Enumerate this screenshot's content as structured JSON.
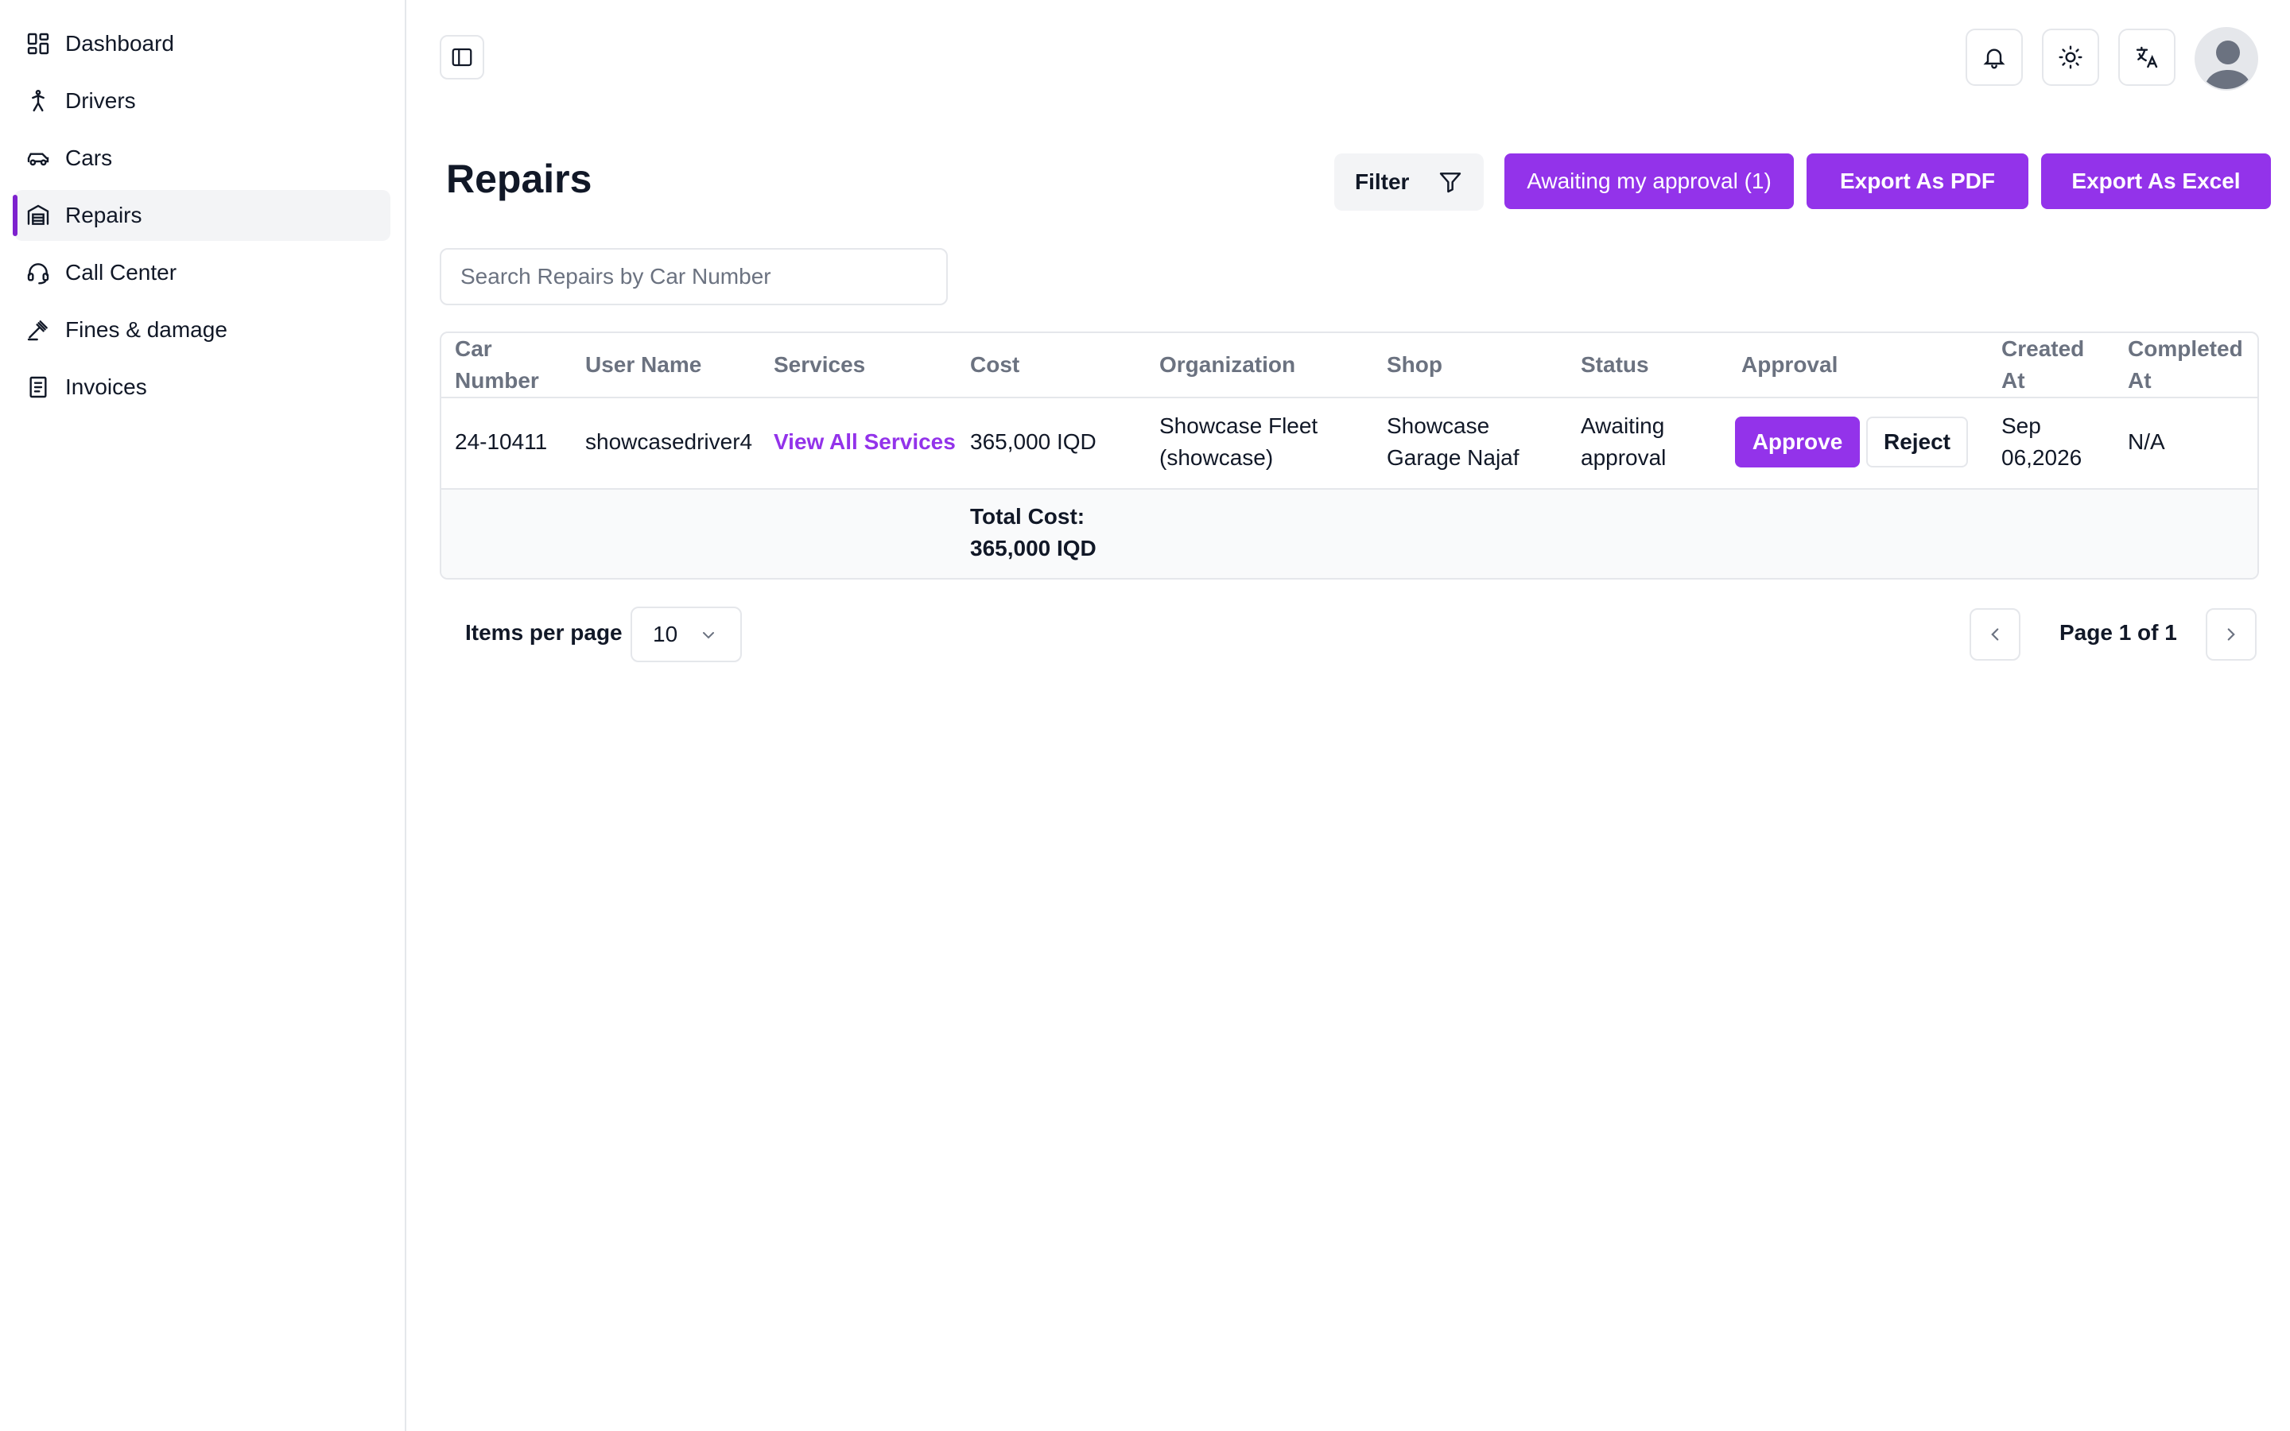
{
  "sidebar": {
    "items": [
      {
        "label": "Dashboard",
        "icon": "dashboard-icon"
      },
      {
        "label": "Drivers",
        "icon": "person-walking-icon"
      },
      {
        "label": "Cars",
        "icon": "car-icon"
      },
      {
        "label": "Repairs",
        "icon": "garage-icon",
        "active": true
      },
      {
        "label": "Call Center",
        "icon": "headset-icon"
      },
      {
        "label": "Fines & damage",
        "icon": "gavel-icon"
      },
      {
        "label": "Invoices",
        "icon": "invoice-icon"
      }
    ]
  },
  "header": {
    "title": "Repairs",
    "filter_label": "Filter",
    "awaiting_label": "Awaiting my approval (1)",
    "export_pdf_label": "Export As PDF",
    "export_excel_label": "Export As Excel"
  },
  "search": {
    "placeholder": "Search Repairs by Car Number",
    "value": ""
  },
  "table": {
    "columns": {
      "car_number_1": "Car",
      "car_number_2": "Number",
      "user_name": "User Name",
      "services": "Services",
      "cost": "Cost",
      "organization": "Organization",
      "shop": "Shop",
      "status": "Status",
      "approval": "Approval",
      "created_at_1": "Created",
      "created_at_2": "At",
      "completed_at_1": "Completed",
      "completed_at_2": "At"
    },
    "rows": [
      {
        "car_number": "24-10411",
        "user_name": "showcasedriver4",
        "services": "View All Services",
        "cost": "365,000 IQD",
        "organization_1": "Showcase Fleet",
        "organization_2": "(showcase)",
        "shop_1": "Showcase",
        "shop_2": "Garage Najaf",
        "status_1": "Awaiting",
        "status_2": "approval",
        "approve_label": "Approve",
        "reject_label": "Reject",
        "created_at_1": "Sep",
        "created_at_2": "06,2026",
        "completed_at": "N/A"
      }
    ],
    "total_label": "Total Cost:",
    "total_value": "365,000 IQD"
  },
  "pagination": {
    "items_per_page_label": "Items per page",
    "items_per_page_value": "10",
    "page_info": "Page 1 of 1"
  },
  "colors": {
    "accent": "#9333ea",
    "border": "#e5e7eb",
    "muted_text": "#6b7280"
  }
}
